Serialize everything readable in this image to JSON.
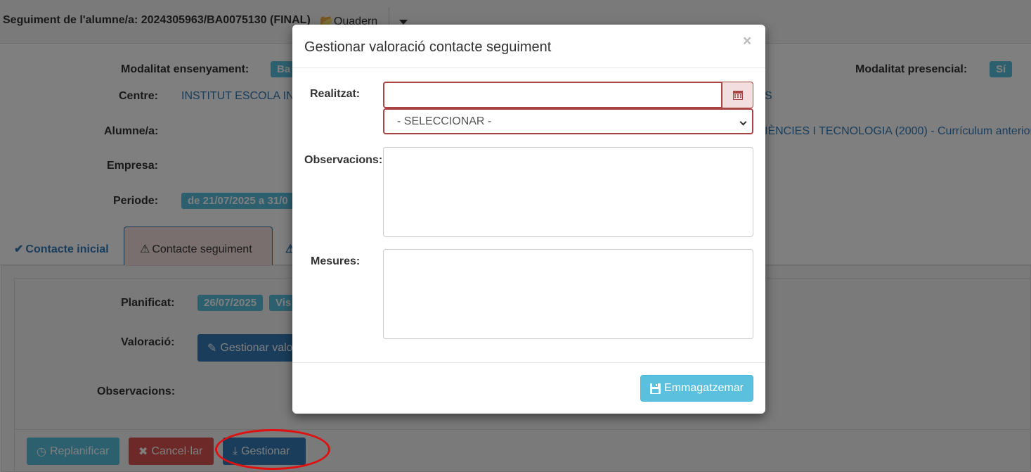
{
  "header": {
    "title": "Seguiment de l'alumne/a: 2024305963/BA0075130  (FINAL)",
    "quadern_label": "Quadern"
  },
  "info": {
    "modalitat_ensenyament_label": "Modalitat ensenyament:",
    "modalitat_ensenyament_badge": "Ba",
    "modalitat_presencial_label": "Modalitat presencial:",
    "modalitat_presencial_badge": "Sí",
    "centre_label": "Centre:",
    "centre_value": "INSTITUT ESCOLA IN",
    "centre_right_fragment": "S",
    "alumne_label": "Alumne/a:",
    "curriculum_value": "IÈNCIES I TECNOLOGIA (2000) - Currículum anterior",
    "empresa_label": "Empresa:",
    "periode_label": "Periode:",
    "periode_badge": "de 21/07/2025 a 31/0"
  },
  "tabs": [
    {
      "label": "Contacte inicial",
      "icon": "check-icon"
    },
    {
      "label": "Contacte seguiment",
      "icon": "warning-icon"
    }
  ],
  "seguiment": {
    "planificat_label": "Planificat:",
    "planificat_date": "26/07/2025",
    "planificat_badge2": "Vis",
    "valoracio_label": "Valoració:",
    "gestionar_valoracio_button": "Gestionar valo",
    "observacions_label": "Observacions:"
  },
  "actions": {
    "replanificar": "Replanificar",
    "cancelar": "Cancel·lar",
    "gestionar": "Gestionar"
  },
  "modal": {
    "title": "Gestionar valoració contacte seguiment",
    "close": "×",
    "realitzat_label": "Realitzat:",
    "realitzat_value": "",
    "select_value": "- SELECCIONAR -",
    "observacions_label": "Observacions:",
    "observacions_value": "",
    "mesures_label": "Mesures:",
    "mesures_value": "",
    "save_button": "Emmagatzemar"
  },
  "colors": {
    "primary": "#337ab7",
    "info": "#5bc0de",
    "danger": "#d9534f",
    "error_border": "#a94442",
    "highlight_circle": "#e01010"
  }
}
